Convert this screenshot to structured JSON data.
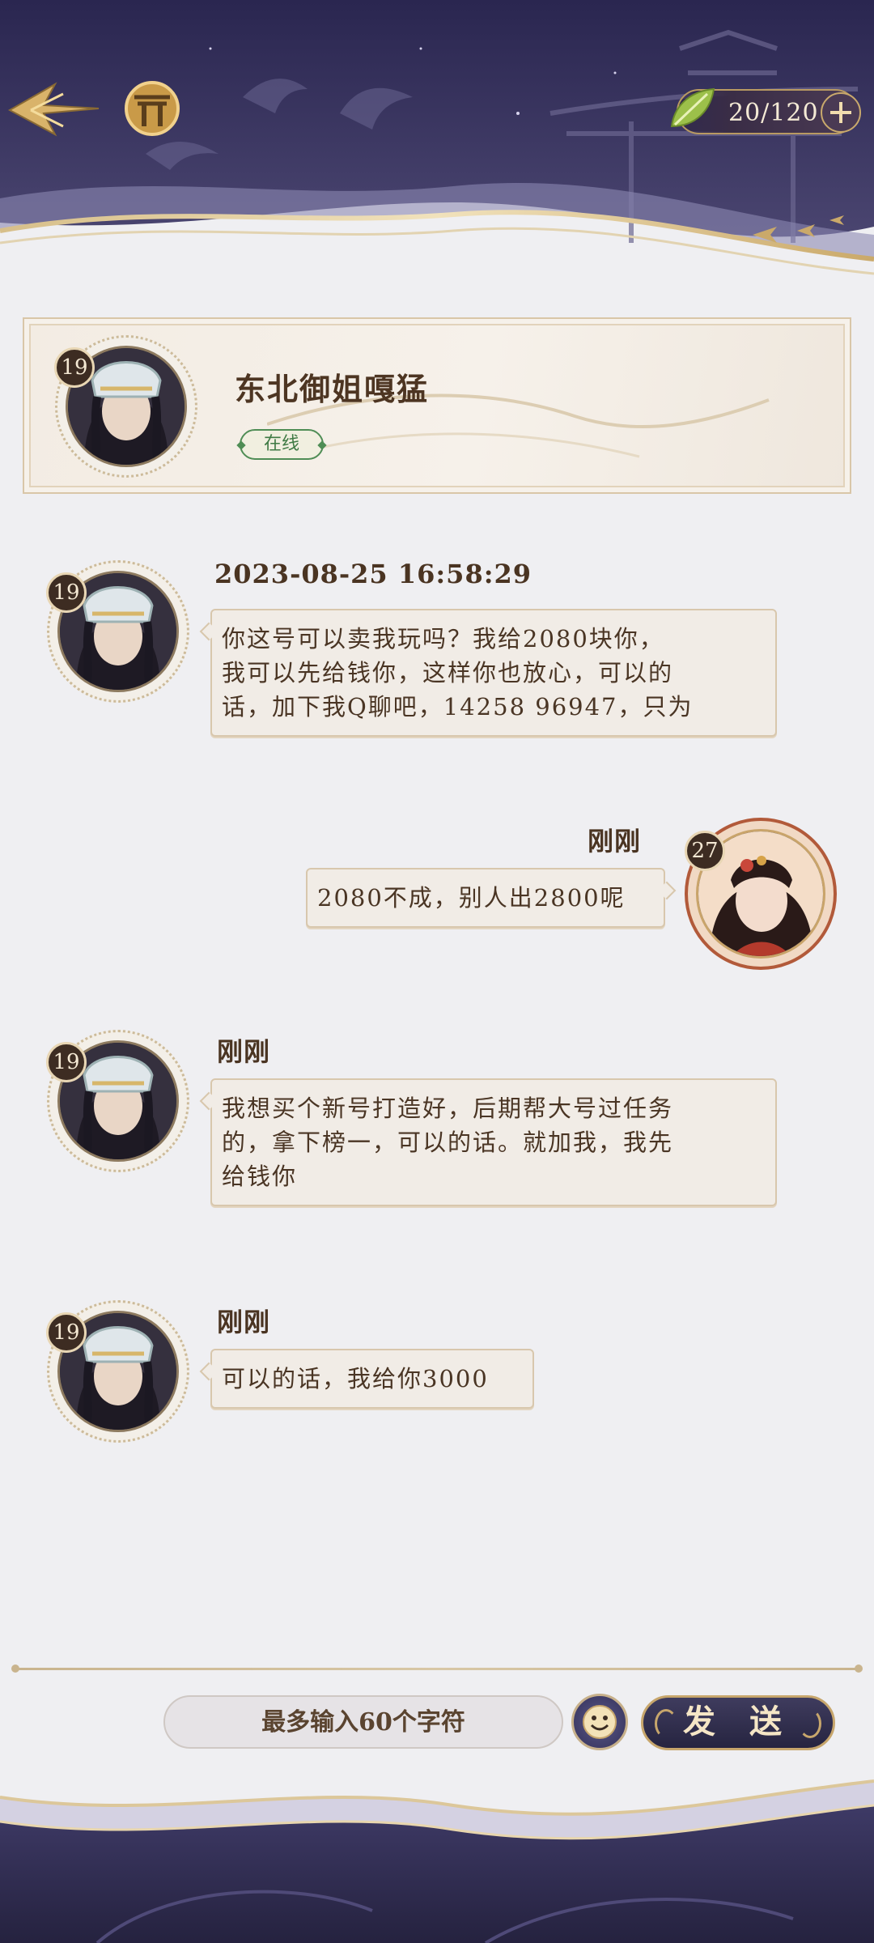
{
  "header": {
    "stamina_count": "20/120",
    "icons": [
      "back-arrow-icon",
      "shrine-gate-icon",
      "leaf-icon",
      "plus-icon"
    ]
  },
  "profile": {
    "name": "东北御姐嘎猛",
    "level": "19",
    "status": "在线"
  },
  "messages": [
    {
      "side": "left",
      "level": "19",
      "time": "2023-08-25 16:58:29",
      "lines": [
        "你这号可以卖我玩吗？我给2080块你，",
        "我可以先给钱你，这样你也放心，可以的",
        "话，加下我Q聊吧，14258 96947，只为"
      ]
    },
    {
      "side": "right",
      "level": "27",
      "time": "刚刚",
      "lines": [
        "2080不成，别人出2800呢"
      ]
    },
    {
      "side": "left",
      "level": "19",
      "time": "刚刚",
      "lines": [
        "我想买个新号打造好，后期帮大号过任务",
        "的，拿下榜一，可以的话。就加我，我先",
        "给钱你"
      ]
    },
    {
      "side": "left",
      "level": "19",
      "time": "刚刚",
      "lines": [
        "可以的话，我给你3000"
      ]
    }
  ],
  "composer": {
    "placeholder": "最多输入60个字符",
    "send_label": "发 送"
  },
  "colors": {
    "night_sky": "#2b2850",
    "gold_accent": "#c7a66c",
    "paper": "#efeff2",
    "online_green": "#4f8d55"
  }
}
